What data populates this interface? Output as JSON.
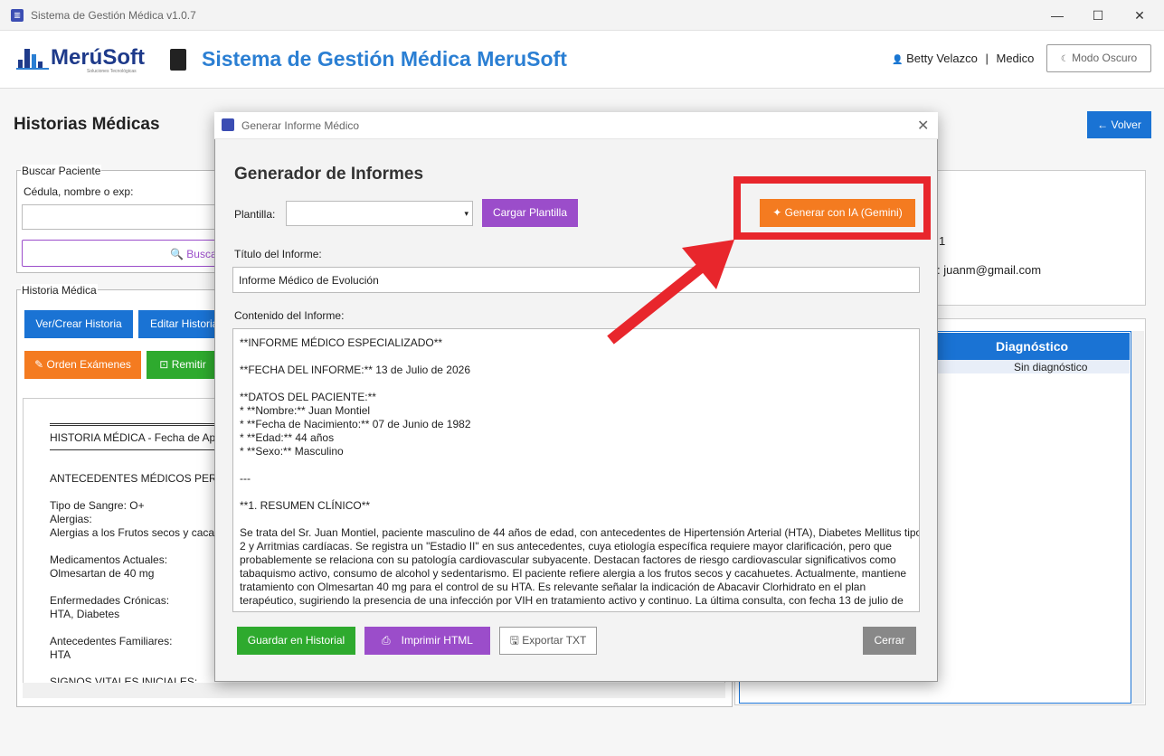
{
  "window": {
    "title": "Sistema de Gestión Médica v1.0.7",
    "icon": "app-icon"
  },
  "header": {
    "logo_text": "MerúSoft",
    "logo_subtitle": "Soluciones Tecnológicas",
    "app_title": "Sistema de Gestión Médica MeruSoft",
    "user_name": "Betty Velazco",
    "separator": "|",
    "user_role": "Medico",
    "dark_mode_label": "Modo Oscuro"
  },
  "page": {
    "title": "Historias Médicas",
    "back_label": "← Volver"
  },
  "search": {
    "legend": "Buscar Paciente",
    "label": "Cédula, nombre o exp:",
    "value": "",
    "button_label": "Buscar"
  },
  "history": {
    "legend": "Historia Médica",
    "buttons": [
      "Ver/Crear Historia",
      "Editar Historia",
      "Orden Exámenes",
      "Remitir"
    ]
  },
  "history_text": {
    "title": "HISTORIA MÉDICA - Fecha de Ape",
    "section1": "ANTECEDENTES MÉDICOS PERSON",
    "blood_type": "Tipo de Sangre: O+",
    "allergies_label": "Alergias:",
    "allergies_value": "Alergias a los Frutos secos y cacahu",
    "meds_label": "Medicamentos Actuales:",
    "meds_value": "Olmesartan de 40 mg",
    "chronic_label": "Enfermedades Crónicas:",
    "chronic_value": "HTA, Diabetes",
    "family_label": "Antecedentes Familiares:",
    "family_value": "HTA",
    "vitals": "SIGNOS VITALES INICIALES:"
  },
  "patient_info": {
    "partial_id": "1",
    "partial_email": ": juanm@gmail.com"
  },
  "table": {
    "column_header": "Diagnóstico",
    "rows": [
      "Sin diagnóstico"
    ]
  },
  "dialog": {
    "title": "Generar Informe Médico",
    "heading": "Generador de Informes",
    "template_label": "Plantilla:",
    "template_value": "",
    "load_template_label": "Cargar Plantilla",
    "ai_button_label": "Generar con IA (Gemini)",
    "report_title_label": "Título del Informe:",
    "report_title_value": "Informe Médico de Evolución",
    "content_label": "Contenido del Informe:",
    "content_lines": [
      "**INFORME MÉDICO ESPECIALIZADO**",
      "",
      "**FECHA DEL INFORME:** 13 de Julio de 2026",
      "",
      "**DATOS DEL PACIENTE:**",
      "*   **Nombre:** Juan Montiel",
      "*   **Fecha de Nacimiento:** 07 de Junio de 1982",
      "*   **Edad:** 44 años",
      "*   **Sexo:** Masculino",
      "",
      "---",
      "",
      "**1. RESUMEN CLÍNICO**",
      "",
      "Se trata del Sr. Juan Montiel, paciente masculino de 44 años de edad, con antecedentes de Hipertensión Arterial (HTA), Diabetes Mellitus tipo",
      "2 y Arritmias cardíacas. Se registra un \"Estadio II\" en sus antecedentes, cuya etiología específica requiere mayor clarificación, pero que",
      "probablemente se relaciona con su patología cardiovascular subyacente. Destacan factores de riesgo cardiovascular significativos como",
      "tabaquismo activo, consumo de alcohol y sedentarismo. El paciente refiere alergia a los frutos secos y cacahuetes. Actualmente, mantiene",
      "tratamiento con Olmesartan 40 mg para el control de su HTA. Es relevante señalar la indicación de Abacavir Clorhidrato en el plan",
      "terapéutico, sugiriendo la presencia de una infección por VIH en tratamiento activo y continuo. La última consulta, con fecha 13 de julio de"
    ],
    "save_label": "Guardar en Historial",
    "print_label": "Imprimir HTML",
    "export_label": "Exportar TXT",
    "close_label": "Cerrar"
  },
  "colors": {
    "accent_blue": "#1a73d4",
    "purple": "#9b4dca",
    "orange": "#f47b20",
    "green": "#2eaa2e",
    "gray": "#888888",
    "highlight_red": "#e8262c"
  }
}
